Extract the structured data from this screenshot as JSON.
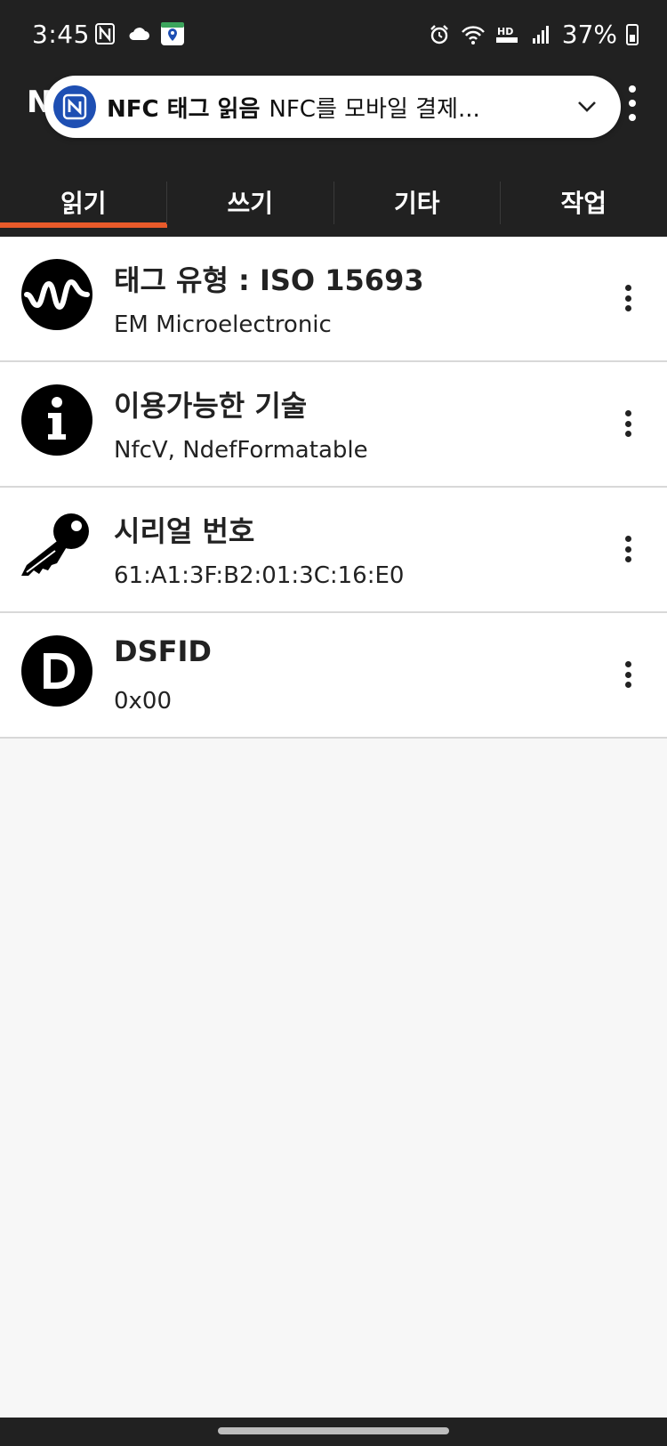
{
  "status": {
    "time": "3:45",
    "battery": "37%",
    "battery_level": 0.37
  },
  "app": {
    "title_peek": "N"
  },
  "notification": {
    "title": "NFC 태그 읽음",
    "text": "NFC를 모바일 결제..."
  },
  "tabs": [
    {
      "label": "읽기",
      "active": true
    },
    {
      "label": "쓰기",
      "active": false
    },
    {
      "label": "기타",
      "active": false
    },
    {
      "label": "작업",
      "active": false
    }
  ],
  "rows": [
    {
      "title": "태그 유형 : ISO 15693",
      "subtitle": "EM Microelectronic",
      "icon": "waveform-icon"
    },
    {
      "title": "이용가능한 기술",
      "subtitle": "NfcV, NdefFormatable",
      "icon": "info-icon"
    },
    {
      "title": "시리얼 번호",
      "subtitle": "61:A1:3F:B2:01:3C:16:E0",
      "icon": "key-icon"
    },
    {
      "title": "DSFID",
      "subtitle": "0x00",
      "icon": "letter-d-icon"
    }
  ],
  "colors": {
    "topbar": "#212121",
    "accent": "#e85a2a",
    "notif_icon": "#1e4fb3"
  }
}
